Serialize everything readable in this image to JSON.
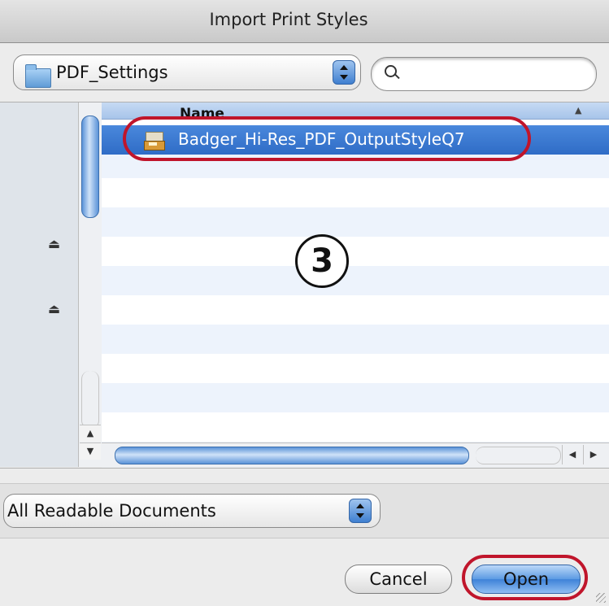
{
  "window": {
    "title": "Import Print Styles"
  },
  "location": {
    "folder": "PDF_Settings",
    "folder_icon": "folder-icon"
  },
  "search": {
    "placeholder": ""
  },
  "file_list": {
    "column_name": "Name",
    "sort_indicator": "▲",
    "items": [
      {
        "name": "Badger_Hi-Res_PDF_OutputStyleQ7",
        "icon": "print-style-file-icon",
        "selected": true
      }
    ]
  },
  "sidebar": {
    "eject_glyph": "⏏"
  },
  "scroll": {
    "up": "▲",
    "down": "▼",
    "left": "◀",
    "right": "▶"
  },
  "filter": {
    "selected": "All Readable Documents"
  },
  "buttons": {
    "cancel": "Cancel",
    "open": "Open"
  },
  "annotations": {
    "step_number": "3",
    "highlight_color": "#c0152b"
  }
}
